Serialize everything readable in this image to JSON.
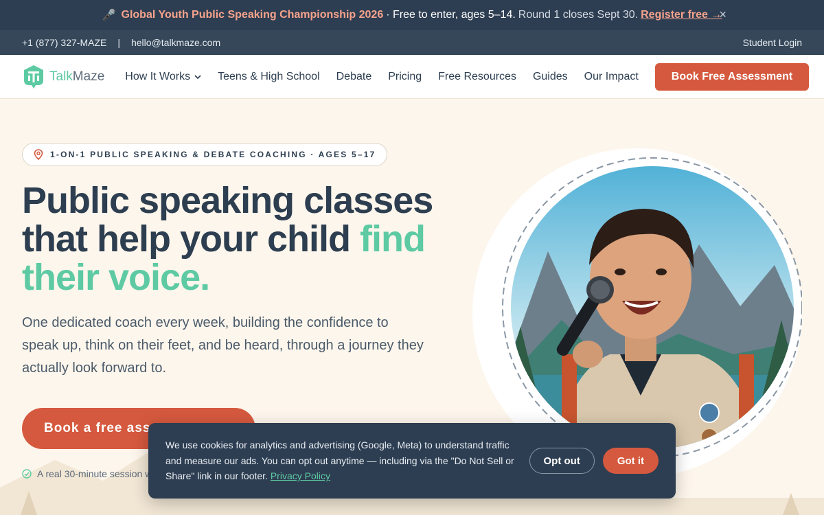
{
  "announcement": {
    "icon": "microphone-icon",
    "highlight": "Global Youth Public Speaking Championship 2026",
    "middle": "· Free to enter, ages 5–14.",
    "detail": "Round 1 closes Sept 30.",
    "link": "Register free →",
    "close": "×"
  },
  "contact": {
    "phone": "+1 (877) 327-MAZE",
    "separator": "|",
    "email": "hello@talkmaze.com",
    "login": "Student Login"
  },
  "nav": {
    "logo_part1": "Talk",
    "logo_part2": "Maze",
    "links": [
      "How It Works",
      "Teens & High School",
      "Debate",
      "Pricing",
      "Free Resources",
      "Guides",
      "Our Impact"
    ],
    "cta": "Book Free Assessment"
  },
  "hero": {
    "pill": "1-ON-1 PUBLIC SPEAKING & DEBATE COACHING · AGES 5–17",
    "headline_part1": "Public speaking classes that help your child ",
    "headline_accent": "find their voice.",
    "lede": "One dedicated coach every week, building the confidence to speak up, think on their feet, and be heard, through a journey they actually look forward to.",
    "cta": "Book a free assessment",
    "note": "A real 30-minute session with a coach"
  },
  "cookie": {
    "text": "We use cookies for analytics and advertising (Google, Meta) to understand traffic and measure our ads. You can opt out anytime — including via the \"Do Not Sell or Share\" link in our footer. ",
    "policy_link": "Privacy Policy",
    "opt_out": "Opt out",
    "got_it": "Got it"
  },
  "colors": {
    "brand_coral": "#d5593e",
    "brand_mint": "#5dcaa3",
    "navy": "#2e3e52",
    "cream": "#fdf6ec"
  }
}
